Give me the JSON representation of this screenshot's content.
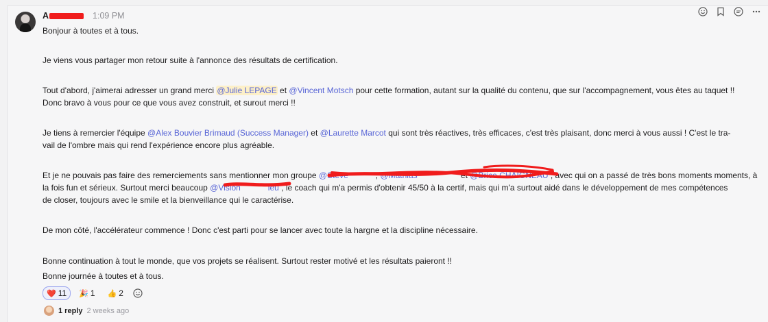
{
  "message": {
    "author_visible": "A",
    "author_tail": "",
    "time": "1:09 PM",
    "paragraphs": {
      "p1": "Bonjour à toutes et à tous.",
      "p2": "Je viens vous partager mon retour suite à l'annonce des résultats de certification.",
      "p3a": "Tout d'abord, j'aimerai adresser un grand merci ",
      "p3_m1": "@Julie LEPAGE",
      "p3b": " et ",
      "p3_m2": "@Vincent Motsch",
      "p3c": " pour cette formation, autant sur la qualité du contenu, que sur l'accompagnement, vous êtes au taquet !!",
      "p3d": "Donc bravo à vous pour ce que vous avez construit, et surout merci !!",
      "p4a": "Je tiens à remercier l'équipe ",
      "p4_m1": "@Alex Bouvier Brimaud (Success Manager)",
      "p4b": "  et ",
      "p4_m2": "@Laurette Marcot",
      "p4c": " qui sont très réactives, très efficaces, c'est très plaisant, donc merci à vous aussi ! C'est le tra-",
      "p4d": "vail de l'ombre mais qui rend l'expérience encore plus agréable.",
      "p5a": "Et je ne pouvais pas faire des remerciements sans mentionner mon groupe ",
      "p5_m1": "@Steve",
      "p5_sep1": ", ",
      "p5_m2": "@Mathias",
      "p5_sep2": " et ",
      "p5_m3": "@Brice CHAIGNEAU",
      "p5b": " , avec qui on a passé de très bons moments moments, à",
      "p5c": "la fois fun et sérieux. Surtout merci beaucoup ",
      "p5_m4": "@Vision",
      "p5_m4tail": "ieu",
      "p5d": " , le coach qui m'a permis d'obtenir 45/50 à la certif, mais qui m'a surtout aidé dans le développement de mes compétences",
      "p5e": "de closer, toujours avec le smile et la bienveillance qui le caractérise.",
      "p6": "De mon côté, l'accélérateur commence ! Donc c'est parti pour se lancer avec toute la hargne et la discipline nécessaire.",
      "p7": "Bonne continuation à tout le monde, que vos projets se réalisent. Surtout rester motivé et les résultats paieront !!",
      "p8": "Bonne journée à toutes et à tous."
    }
  },
  "reactions": [
    {
      "emoji": "❤️",
      "count": "11",
      "active": true,
      "icon": "heart-icon"
    },
    {
      "emoji": "🎉",
      "count": "1",
      "active": false,
      "icon": "party-popper-icon"
    },
    {
      "emoji": "👍",
      "count": "2",
      "active": false,
      "icon": "thumbs-up-icon"
    }
  ],
  "thread": {
    "replies": "1 reply",
    "ago": "2 weeks ago"
  },
  "toolbar": {
    "icons": [
      "add-reaction-icon",
      "bookmark-icon",
      "reply-in-thread-icon",
      "more-actions-icon"
    ]
  },
  "colors": {
    "mention": "#5865d6",
    "redaction": "#f01c1c",
    "highlight": "#fdf0c8"
  }
}
